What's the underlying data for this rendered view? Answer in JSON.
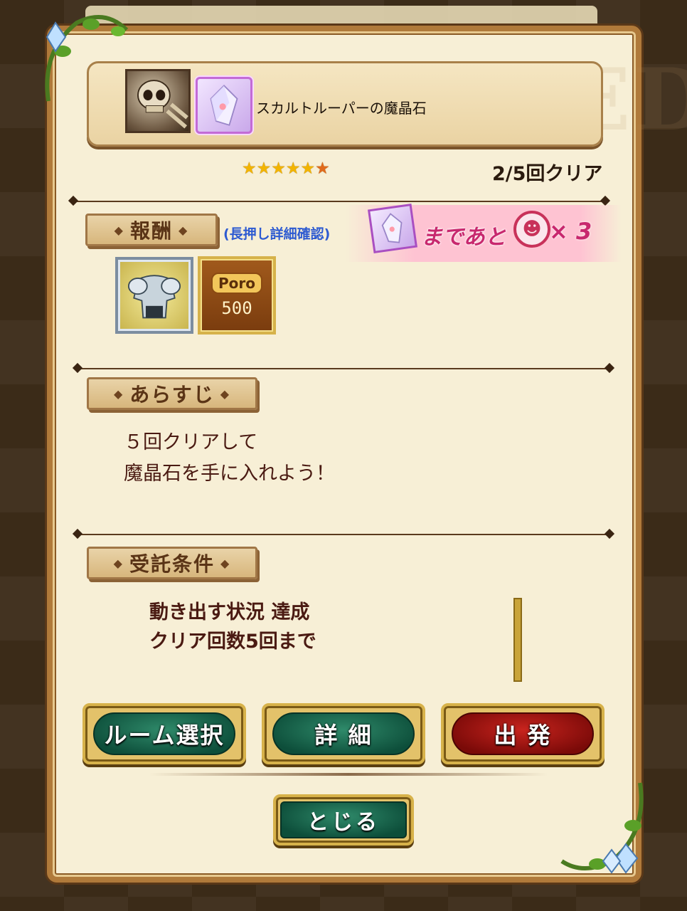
{
  "quest": {
    "title": "スカルトルーパーの魔晶石",
    "watermark": "WANTED",
    "stars": "★★★★★",
    "star_extra": "★",
    "clear_count": "2/5回クリア"
  },
  "reward": {
    "heading": "報酬",
    "hint": "(長押し詳細確認)",
    "ribbon_text": "まであと",
    "ribbon_multiplier": "× 3",
    "poro_label": "Poro",
    "poro_amount": "500"
  },
  "synopsis": {
    "heading": "あらすじ",
    "line1": "５回クリアして",
    "line2": "魔晶石を手に入れよう！"
  },
  "conditions": {
    "heading": "受託条件",
    "line1": "動き出す状況 達成",
    "line2": "クリア回数5回まで"
  },
  "buttons": {
    "room_select": "ルーム選択",
    "details": "詳 細",
    "depart": "出 発",
    "close": "とじる"
  },
  "colors": {
    "panel_bg": "#f7efd6",
    "frame": "#b07a3a",
    "button_green": "#0d4e3a",
    "button_red": "#7a0a08",
    "hint_blue": "#2e5bd1",
    "ribbon_pink": "#c8286e"
  }
}
